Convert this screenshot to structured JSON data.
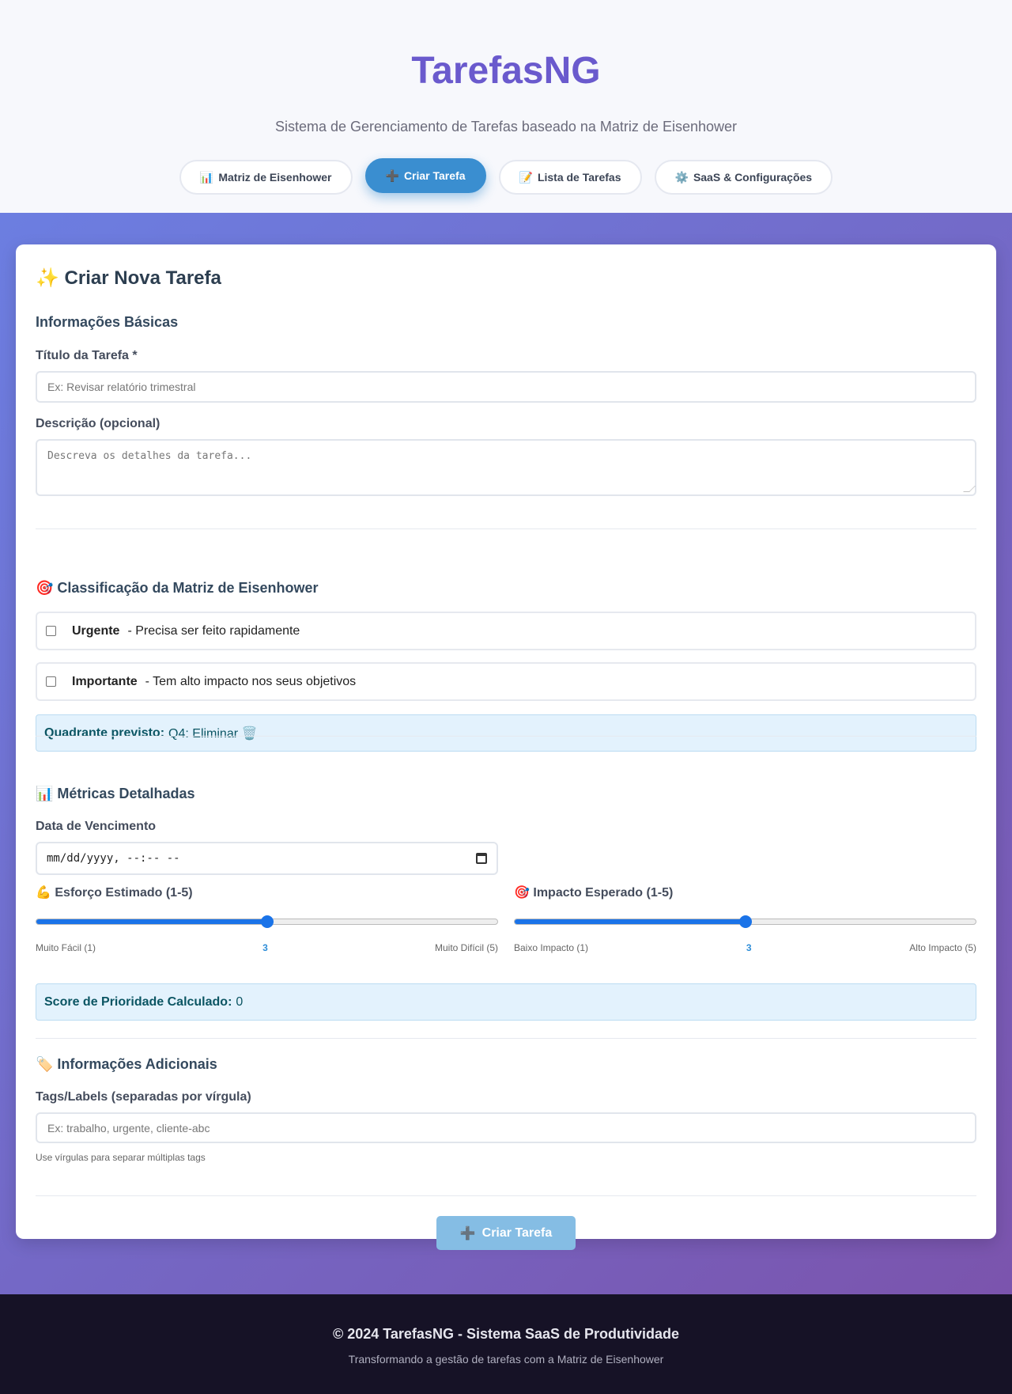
{
  "header": {
    "title": "TarefasNG",
    "subtitle": "Sistema de Gerenciamento de Tarefas baseado na Matriz de Eisenhower"
  },
  "nav": [
    {
      "icon": "📊",
      "label": "Matriz de Eisenhower",
      "active": false
    },
    {
      "icon": "➕",
      "label": "Criar Tarefa",
      "active": true
    },
    {
      "icon": "📝",
      "label": "Lista de Tarefas",
      "active": false
    },
    {
      "icon": "⚙️",
      "label": "SaaS & Configurações",
      "active": false
    }
  ],
  "form": {
    "title": "✨ Criar Nova Tarefa",
    "basic": {
      "section": "Informações Básicas",
      "title_label": "Título da Tarefa *",
      "title_placeholder": "Ex: Revisar relatório trimestral",
      "desc_label": "Descrição (opcional)",
      "desc_placeholder": "Descreva os detalhes da tarefa..."
    },
    "matrix": {
      "section": "🎯 Classificação da Matriz de Eisenhower",
      "urgent_label": "Urgente",
      "urgent_desc": "- Precisa ser feito rapidamente",
      "important_label": "Importante",
      "important_desc": "- Tem alto impacto nos seus objetivos",
      "quadrant_label": "Quadrante previsto:",
      "quadrant_value": "Q4: Eliminar 🗑️"
    },
    "metrics": {
      "section": "📊 Métricas Detalhadas",
      "due_label": "Data de Vencimento",
      "due_value": "mm/dd/yyyy, --:-- --",
      "effort": {
        "label": "💪 Esforço Estimado (1-5)",
        "min_label": "Muito Fácil (1)",
        "max_label": "Muito Difícil (5)",
        "value": "3",
        "fraction": 0.5
      },
      "impact": {
        "label": "🎯 Impacto Esperado (1-5)",
        "min_label": "Baixo Impacto (1)",
        "max_label": "Alto Impacto (5)",
        "value": "3",
        "fraction": 0.5
      },
      "score_label": "Score de Prioridade Calculado:",
      "score_value": "0"
    },
    "additional": {
      "section": "🏷️ Informações Adicionais",
      "tags_label": "Tags/Labels (separadas por vírgula)",
      "tags_placeholder": "Ex: trabalho, urgente, cliente-abc",
      "tags_hint": "Use vírgulas para separar múltiplas tags"
    },
    "submit_icon": "➕",
    "submit_label": "Criar Tarefa"
  },
  "footer": {
    "title": "© 2024 TarefasNG - Sistema SaaS de Produtividade",
    "subtitle": "Transformando a gestão de tarefas com a Matriz de Eisenhower"
  },
  "colors": {
    "brand": "#6a5acd",
    "accent": "#3a8ed0",
    "slider": "#1a73e8"
  }
}
